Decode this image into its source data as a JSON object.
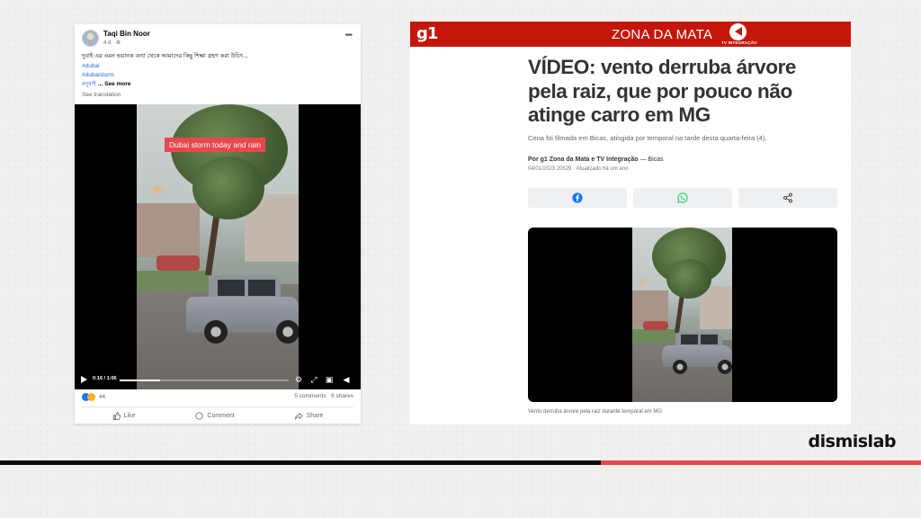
{
  "facebook_post": {
    "author": "Taqi Bin Noor",
    "time": "4 d ·",
    "text": "দুবাই এর এমন ভয়ানক বন্যা থেকে আমাদের কিছু শিক্ষা গ্রহণ করা উচিৎ...",
    "hashtags": [
      "#dubai",
      "#dubaistorm",
      "#দুবাই"
    ],
    "see_more": "... See more",
    "see_translation": "See translation",
    "video": {
      "overlay_caption": "Dubai storm today and rain",
      "time": "0:16 / 1:06",
      "progress": 0.24
    },
    "reactions_count": "44",
    "comments": "5 comments",
    "shares": "6 shares",
    "actions": {
      "like": "Like",
      "comment": "Comment",
      "share": "Share"
    },
    "colors": {
      "link": "#216fdb",
      "caption_bg": "#e8474e"
    }
  },
  "g1_article": {
    "logo": "g1",
    "region": "ZONA DA MATA",
    "tv_label": "TV INTEGRAÇÃO",
    "title": "VÍDEO: vento derruba árvore pela raiz, que por pouco não atinge carro em MG",
    "subtitle": "Cena foi filmada em Bicas, atingida por temporal na tarde desta quarta-feira (4).",
    "byline_prefix": "Por g1 Zona da Mata e TV Integração",
    "byline_location": " — Bicas",
    "date": "04/01/2023 20h29 · Atualizado há um ano",
    "share_buttons": [
      "facebook-icon",
      "whatsapp-icon",
      "share-icon"
    ],
    "video_caption": "Vento derruba árvore pela raiz durante temporal em MG",
    "colors": {
      "header": "#c4170c"
    }
  },
  "brand": {
    "logo": "dismislab",
    "stripe_colors": [
      "#0a0a0a",
      "#e8474e"
    ]
  }
}
